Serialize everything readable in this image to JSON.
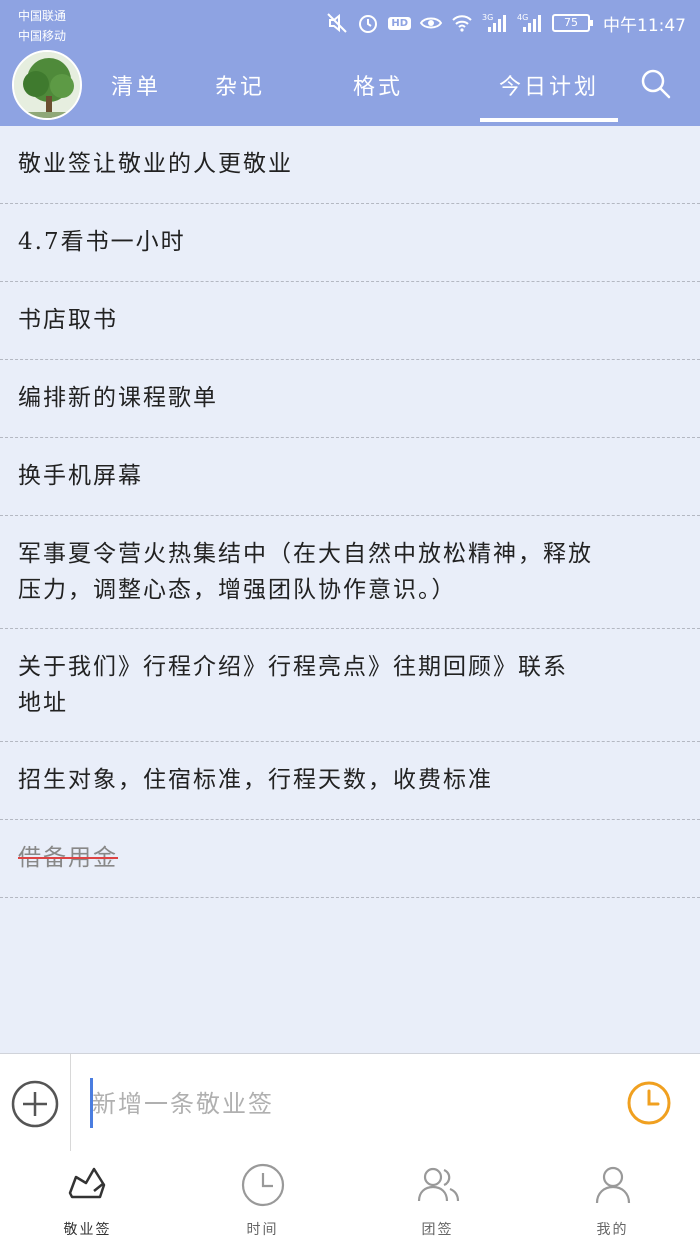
{
  "status_bar": {
    "carrier_1": "中国联通",
    "carrier_2": "中国移动",
    "network_3g": "3G",
    "network_4g": "4G",
    "battery": "75",
    "time": "中午11:47"
  },
  "header": {
    "tabs": [
      {
        "label": "清单"
      },
      {
        "label": "杂记"
      },
      {
        "label": "格式"
      },
      {
        "label": "今日计划"
      }
    ],
    "active_tab": "今日计划",
    "search_icon": "search-icon"
  },
  "list": {
    "items": [
      {
        "text": "敬业签让敬业的人更敬业",
        "done": false
      },
      {
        "text": "4.7看书一小时",
        "done": false
      },
      {
        "text": "书店取书",
        "done": false
      },
      {
        "text": "编排新的课程歌单",
        "done": false
      },
      {
        "text": "换手机屏幕",
        "done": false
      },
      {
        "text": "军事夏令营火热集结中（在大自然中放松精神，释放压力，调整心态，增强团队协作意识。）",
        "done": false
      },
      {
        "text": "关于我们》行程介绍》行程亮点》往期回顾》联系地址",
        "done": false
      },
      {
        "text": "招生对象，住宿标准，行程天数，收费标准",
        "done": false
      },
      {
        "text": "借备用金",
        "done": true
      }
    ]
  },
  "input_bar": {
    "placeholder": "新增一条敬业签",
    "value": ""
  },
  "bottom_nav": {
    "items": [
      {
        "label": "敬业签",
        "icon": "notes-icon"
      },
      {
        "label": "时间",
        "icon": "clock-icon"
      },
      {
        "label": "团签",
        "icon": "team-icon"
      },
      {
        "label": "我的",
        "icon": "person-icon"
      }
    ],
    "active": "敬业签"
  },
  "colors": {
    "header": "#8ea3e2",
    "background": "#e9eef9",
    "reminder_accent": "#f0a020",
    "caret": "#4a7de0",
    "strike": "#dd4444"
  }
}
